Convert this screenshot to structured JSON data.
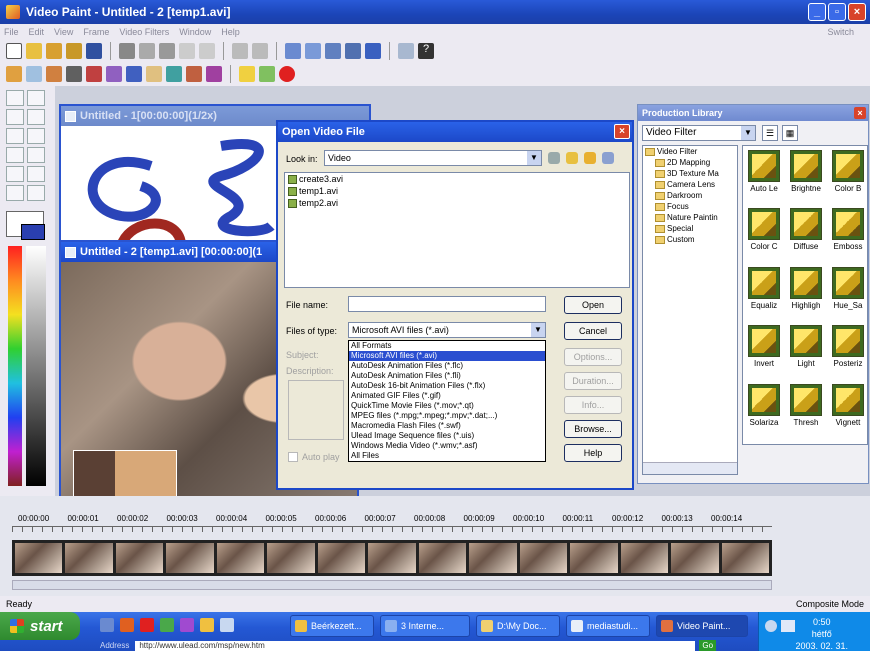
{
  "app": {
    "title": "Video Paint - Untitled - 2 [temp1.avi]",
    "menu": [
      "File",
      "Edit",
      "View",
      "Frame",
      "Video Filters",
      "Window",
      "Help"
    ],
    "switch_label": "Switch"
  },
  "doc1": {
    "title": "Untitled - 1[00:00:00](1/2x)"
  },
  "doc2": {
    "title": "Untitled - 2 [temp1.avi] [00:00:00](1"
  },
  "library": {
    "title": "Production Library",
    "category": "Video Filter",
    "tree": [
      "Video Filter",
      "2D Mapping",
      "3D Texture Ma",
      "Camera Lens",
      "Darkroom",
      "Focus",
      "Nature Paintin",
      "Special",
      "Custom"
    ],
    "thumbs": [
      "Auto Le",
      "Brightne",
      "Color B",
      "Color C",
      "Diffuse",
      "Emboss",
      "Equaliz",
      "Highligh",
      "Hue_Sa",
      "Invert",
      "Light",
      "Posteriz",
      "Solariza",
      "Thresh",
      "Vignett"
    ]
  },
  "dialog": {
    "title": "Open Video File",
    "look_in_label": "Look in:",
    "look_in_value": "Video",
    "files": [
      "create3.avi",
      "temp1.avi",
      "temp2.avi"
    ],
    "file_name_label": "File name:",
    "file_name_value": "",
    "files_of_type_label": "Files of type:",
    "files_of_type_value": "Microsoft AVI files (*.avi)",
    "subject_label": "Subject:",
    "description_label": "Description:",
    "auto_play_label": "Auto play",
    "buttons": {
      "open": "Open",
      "cancel": "Cancel",
      "options": "Options...",
      "duration": "Duration...",
      "info": "Info...",
      "browse": "Browse...",
      "help": "Help"
    },
    "type_options": [
      "All Formats",
      "Microsoft AVI files (*.avi)",
      "AutoDesk Animation Files (*.flc)",
      "AutoDesk Animation Files (*.fli)",
      "AutoDesk 16-bit Animation Files (*.flx)",
      "Animated GIF Files (*.gif)",
      "QuickTime Movie Files (*.mov;*.qt)",
      "MPEG files (*.mpg;*.mpeg;*.mpv;*.dat;...)",
      "Macromedia Flash Files (*.swf)",
      "Ulead Image Sequence files (*.uis)",
      "Windows Media Video (*.wmv;*.asf)",
      "All Files"
    ],
    "selected_index": 1
  },
  "timeline": {
    "ticks": [
      "00:00:00",
      "00:00:01",
      "00:00:02",
      "00:00:03",
      "00:00:04",
      "00:00:05",
      "00:00:06",
      "00:00:07",
      "00:00:08",
      "00:00:09",
      "00:00:10",
      "00:00:11",
      "00:00:12",
      "00:00:13",
      "00:00:14"
    ]
  },
  "status": {
    "left": "Ready",
    "right": "Composite Mode"
  },
  "taskbar": {
    "start": "start",
    "tasks": [
      "Beérkezett...",
      "3 Interne...",
      "D:\\My Doc...",
      "mediastudi...",
      "Video Paint..."
    ],
    "clock_time": "0:50",
    "clock_day": "hétfő",
    "clock_date": "2003. 02. 31.",
    "address_label": "Address",
    "address_url": "http://www.ulead.com/msp/new.htm",
    "go": "Go"
  },
  "colors": {
    "accent": "#1c48c8",
    "selection": "#2a4ed0",
    "start_green": "#2f8a2f"
  }
}
